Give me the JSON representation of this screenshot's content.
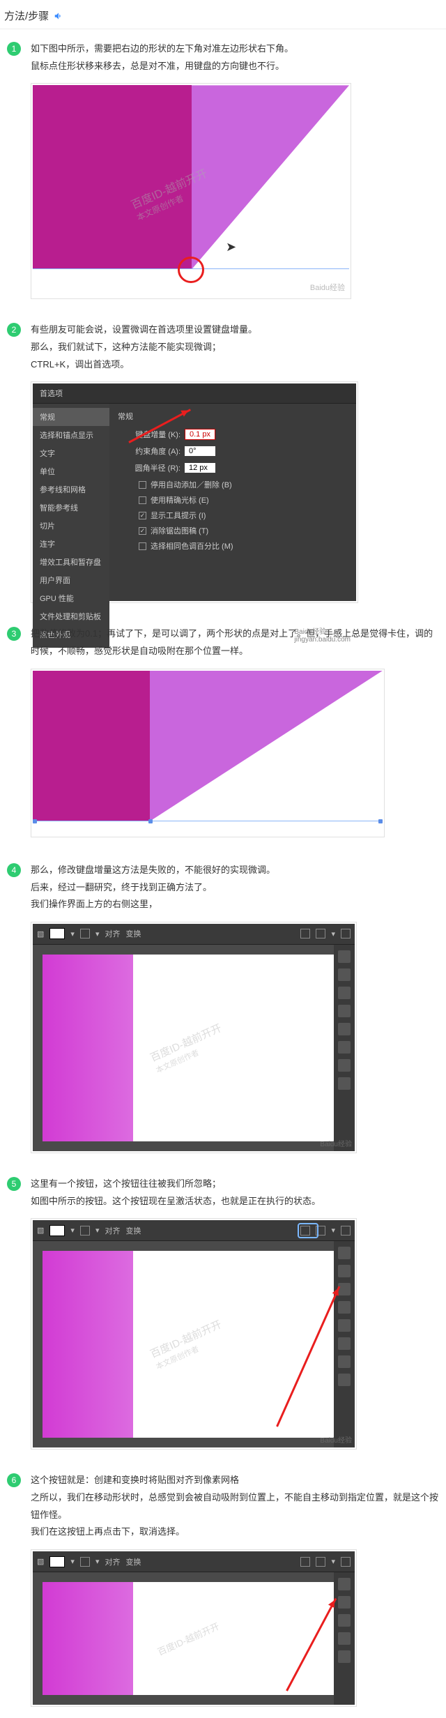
{
  "header": {
    "title": "方法/步骤"
  },
  "steps": [
    {
      "num": "1",
      "lines": [
        "如下图中所示，需要把右边的形状的左下角对准左边形状右下角。",
        "鼠标点住形状移来移去，总是对不准，用键盘的方向键也不行。"
      ]
    },
    {
      "num": "2",
      "lines": [
        "有些朋友可能会说，设置微调在首选项里设置键盘增量。",
        "那么，我们就试下，这种方法能不能实现微调；",
        "CTRL+K，调出首选项。"
      ]
    },
    {
      "num": "3",
      "lines": [
        "把数值修改为0.1；再试了下，是可以调了，两个形状的点是对上了。但，手感上总是觉得卡住，调的时候，不顺畅，感觉形状是自动吸附在那个位置一样。"
      ]
    },
    {
      "num": "4",
      "lines": [
        "那么，修改键盘增量这方法是失败的，不能很好的实现微调。",
        "后来，经过一翻研究，终于找到正确方法了。",
        "我们操作界面上方的右侧这里，"
      ]
    },
    {
      "num": "5",
      "lines": [
        "这里有一个按钮，这个按钮往往被我们所忽略；",
        "如图中所示的按钮。这个按钮现在呈激活状态，也就是正在执行的状态。"
      ]
    },
    {
      "num": "6",
      "lines": [
        "这个按钮就是：创建和变换时将贴图对齐到像素网格",
        "之所以，我们在移动形状时，总感觉到会被自动吸附到位置上，不能自主移动到指定位置，就是这个按钮作怪。",
        "我们在这按钮上再点击下，取消选择。"
      ]
    }
  ],
  "pref": {
    "title": "首选项",
    "side": [
      "常规",
      "选择和锚点显示",
      "文字",
      "单位",
      "参考线和网格",
      "智能参考线",
      "切片",
      "连字",
      "增效工具和暂存盘",
      "用户界面",
      "GPU 性能",
      "文件处理和剪贴板",
      "黑色外观"
    ],
    "heading": "常规",
    "r1label": "键盘增量 (K):",
    "r1val": "0.1 px",
    "r2label": "约束角度 (A):",
    "r2val": "0°",
    "r3label": "圆角半径 (R):",
    "r3val": "12 px",
    "chk": [
      {
        "c": false,
        "t": "停用自动添加／删除 (B)"
      },
      {
        "c": false,
        "t": "使用精确光标 (E)"
      },
      {
        "c": true,
        "t": "显示工具提示 (I)"
      },
      {
        "c": true,
        "t": "消除锯齿图稿 (T)"
      },
      {
        "c": false,
        "t": "选择相同色调百分比 (M)"
      }
    ],
    "wm": "jingyan.baidu.com"
  },
  "app": {
    "align": "对齐",
    "transform": "变换"
  },
  "watermark": "百度ID-越前开开",
  "wm_sub": "本文原创作者",
  "corner": "Baidu经验"
}
